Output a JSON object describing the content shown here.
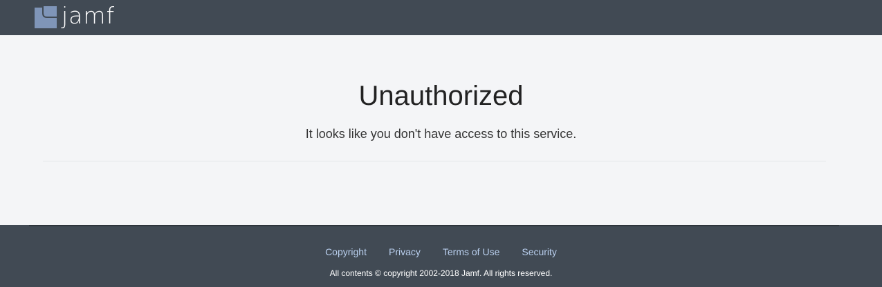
{
  "header": {
    "logo_text": "jamf",
    "logo_icon": "jamf-logo-mark",
    "logo_color": "#7f95b8"
  },
  "main": {
    "title": "Unauthorized",
    "message": "It looks like you don't have access to this service."
  },
  "footer": {
    "links": [
      {
        "label": "Copyright"
      },
      {
        "label": "Privacy"
      },
      {
        "label": "Terms of Use"
      },
      {
        "label": "Security"
      }
    ],
    "copyright": "All contents © copyright 2002-2018 Jamf. All rights reserved."
  },
  "colors": {
    "header_bg": "#414a54",
    "footer_bg": "#414a54",
    "page_bg": "#f4f5f7",
    "link": "#b9cfee"
  }
}
